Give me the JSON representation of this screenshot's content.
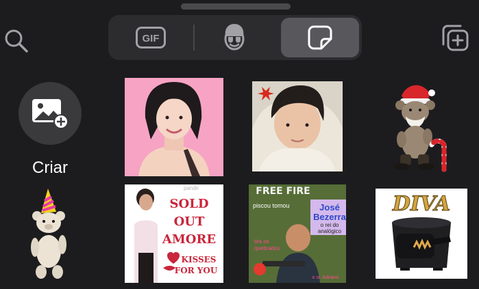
{
  "tabs": [
    {
      "name": "gif",
      "icon": "gif-icon",
      "label": "GIF"
    },
    {
      "name": "avatar",
      "icon": "avatar-icon"
    },
    {
      "name": "stickers",
      "icon": "sticker-icon",
      "active": true
    }
  ],
  "create": {
    "label": "Criar",
    "icon": "add-image-icon"
  },
  "stickers": {
    "sold": {
      "line1": "SOLD",
      "line2": "OUT",
      "line3": "AMORE",
      "line4": "KISSES",
      "line5": "FOR YOU",
      "watermark": "pandir"
    },
    "meme": {
      "title": "FREE FIRE",
      "name1": "José",
      "name2": "Bezerra",
      "sub1": "o rei do",
      "sub2": "analógico",
      "tl1": "piscou tomou",
      "bl1": "tira os",
      "bl2": "quebrados",
      "foot": "o sr. Adriano"
    },
    "diva": {
      "text": "DIVA"
    }
  },
  "colors": {
    "background": "#1c1c1e",
    "segment": "#2c2c2e",
    "segment_active": "#58585c",
    "create_circle": "#3a3a3c",
    "icon": "#a1a1a6"
  }
}
